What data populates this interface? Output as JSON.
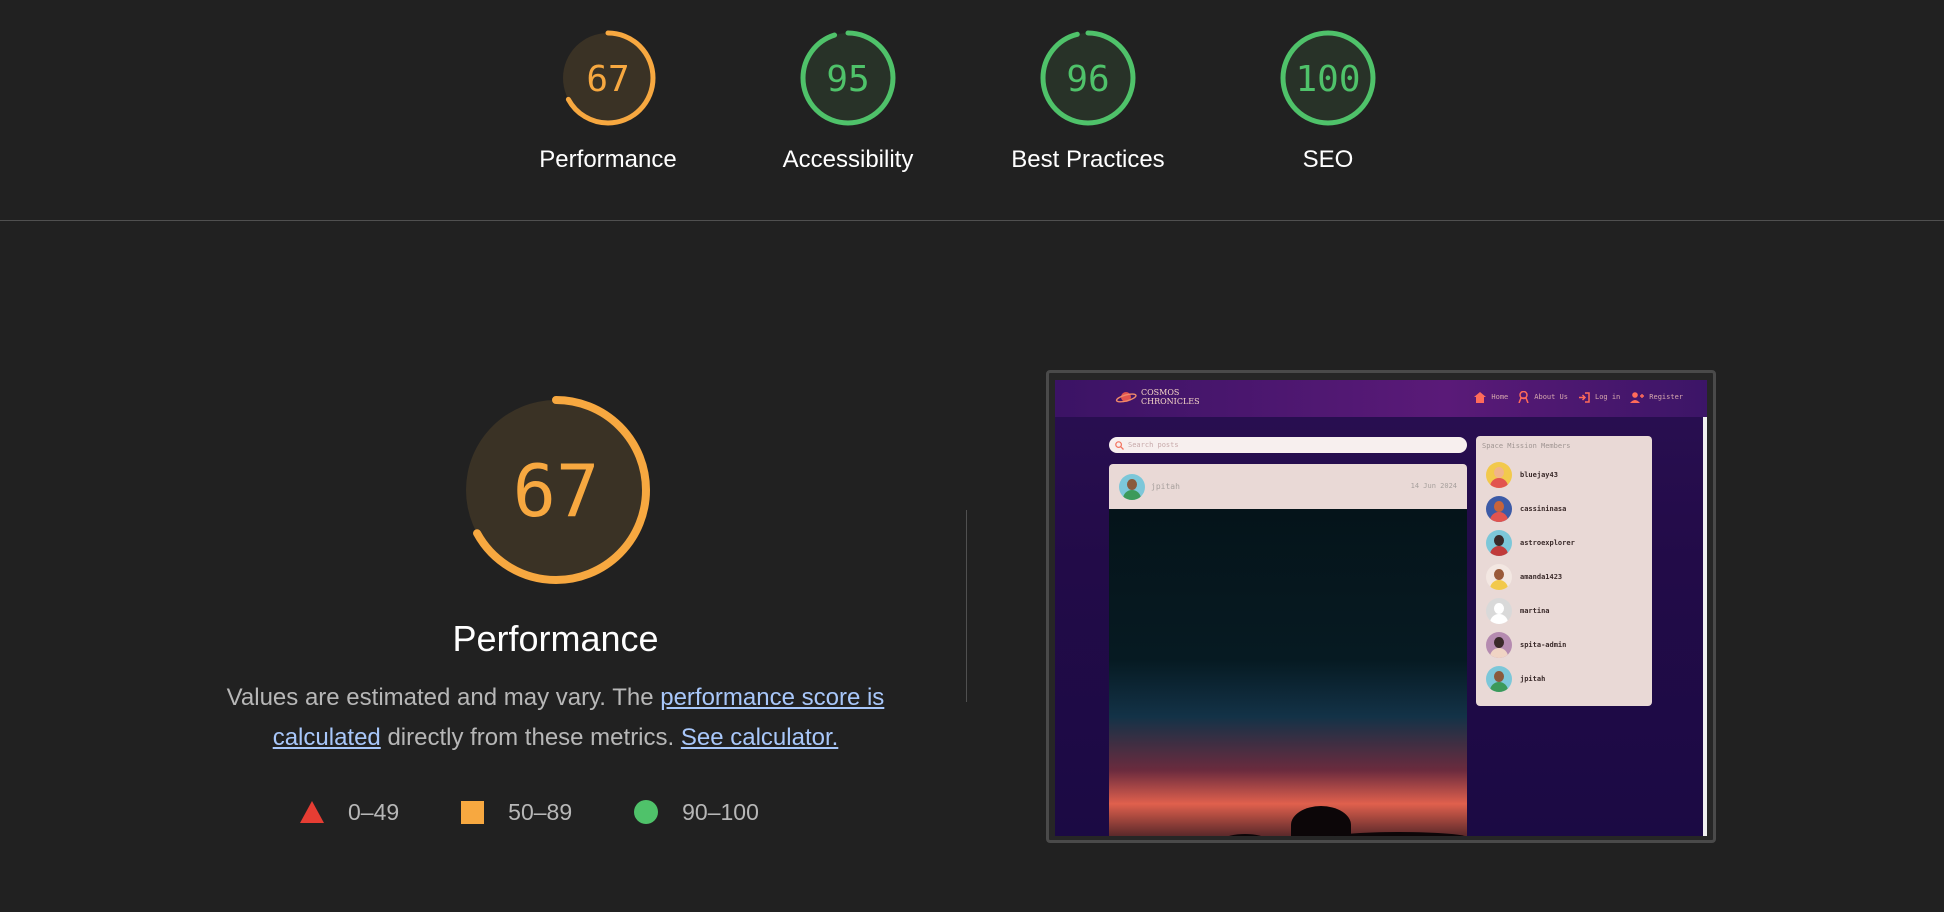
{
  "summary_scores": [
    {
      "label": "Performance",
      "score": "67",
      "value": 0.67,
      "color": "#f7a840",
      "bg": "#3a3225"
    },
    {
      "label": "Accessibility",
      "score": "95",
      "value": 0.95,
      "color": "#4fc26a",
      "bg": "#283228"
    },
    {
      "label": "Best Practices",
      "score": "96",
      "value": 0.96,
      "color": "#4fc26a",
      "bg": "#283228"
    },
    {
      "label": "SEO",
      "score": "100",
      "value": 1.0,
      "color": "#4fc26a",
      "bg": "#283228"
    }
  ],
  "performance": {
    "score": "67",
    "value": 0.67,
    "title": "Performance",
    "desc_prefix": "Values are estimated and may vary. The ",
    "desc_link": "performance score is calculated",
    "desc_middle": " directly from these metrics. ",
    "calculator_link": "See calculator."
  },
  "legend": {
    "fail": "0–49",
    "average": "50–89",
    "pass": "90–100"
  },
  "colors": {
    "fail": "#e63d33",
    "average": "#f7a840",
    "pass": "#4fc26a",
    "link": "#a8c7fa"
  },
  "preview": {
    "logo_line1": "COSMOS",
    "logo_line2": "CHRONICLES",
    "nav": [
      "Home",
      "About Us",
      "Log in",
      "Register"
    ],
    "search_placeholder": "Search posts",
    "post_author": "jpitah",
    "post_date": "14 Jun 2024",
    "members_title": "Space Mission Members",
    "members": [
      "bluejay43",
      "cassininasa",
      "astroexplorer",
      "amanda1423",
      "martina",
      "spita-admin",
      "jpitah"
    ]
  }
}
